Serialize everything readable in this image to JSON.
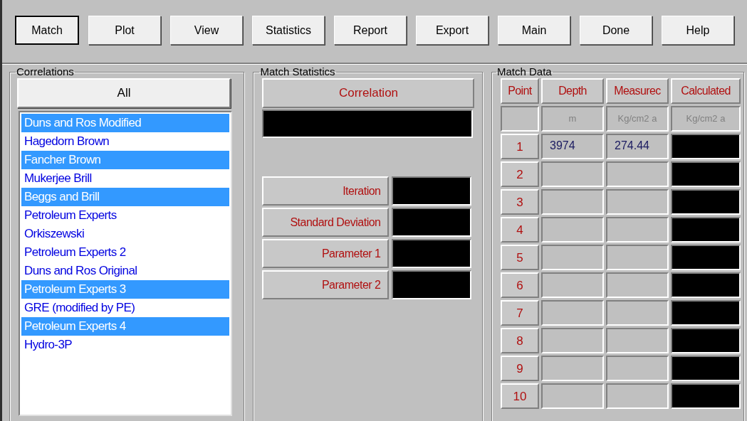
{
  "toolbar": {
    "buttons": [
      {
        "label": "Match",
        "selected": true
      },
      {
        "label": "Plot",
        "selected": false
      },
      {
        "label": "View",
        "selected": false
      },
      {
        "label": "Statistics",
        "selected": false
      },
      {
        "label": "Report",
        "selected": false
      },
      {
        "label": "Export",
        "selected": false
      },
      {
        "label": "Main",
        "selected": false
      },
      {
        "label": "Done",
        "selected": false
      },
      {
        "label": "Help",
        "selected": false
      }
    ]
  },
  "correlations": {
    "title": "Correlations",
    "all_button": "All",
    "items": [
      {
        "label": "Duns and Ros Modified",
        "selected": true
      },
      {
        "label": "Hagedorn Brown",
        "selected": false
      },
      {
        "label": "Fancher Brown",
        "selected": true
      },
      {
        "label": "Mukerjee Brill",
        "selected": false
      },
      {
        "label": "Beggs and Brill",
        "selected": true
      },
      {
        "label": "Petroleum Experts",
        "selected": false
      },
      {
        "label": "Orkiszewski",
        "selected": false
      },
      {
        "label": "Petroleum Experts 2",
        "selected": false
      },
      {
        "label": "Duns and Ros Original",
        "selected": false
      },
      {
        "label": "Petroleum Experts 3",
        "selected": true
      },
      {
        "label": "GRE (modified by PE)",
        "selected": false
      },
      {
        "label": "Petroleum Experts 4",
        "selected": true
      },
      {
        "label": "Hydro-3P",
        "selected": false
      }
    ]
  },
  "match_statistics": {
    "title": "Match Statistics",
    "correlation_label": "Correlation",
    "fields": [
      {
        "label": "Iteration"
      },
      {
        "label": "Standard Deviation"
      },
      {
        "label": "Parameter 1"
      },
      {
        "label": "Parameter 2"
      }
    ]
  },
  "match_data": {
    "title": "Match Data",
    "columns": [
      {
        "label": "Point"
      },
      {
        "label": "Depth",
        "unit": "m"
      },
      {
        "label": "Measurec",
        "unit": "Kg/cm2 a"
      },
      {
        "label": "Calculated",
        "unit": "Kg/cm2 a"
      }
    ],
    "rows": [
      {
        "point": "1",
        "depth": "3974",
        "measured": "274.44"
      },
      {
        "point": "2"
      },
      {
        "point": "3"
      },
      {
        "point": "4"
      },
      {
        "point": "5"
      },
      {
        "point": "6"
      },
      {
        "point": "7"
      },
      {
        "point": "8"
      },
      {
        "point": "9"
      },
      {
        "point": "10"
      }
    ]
  }
}
